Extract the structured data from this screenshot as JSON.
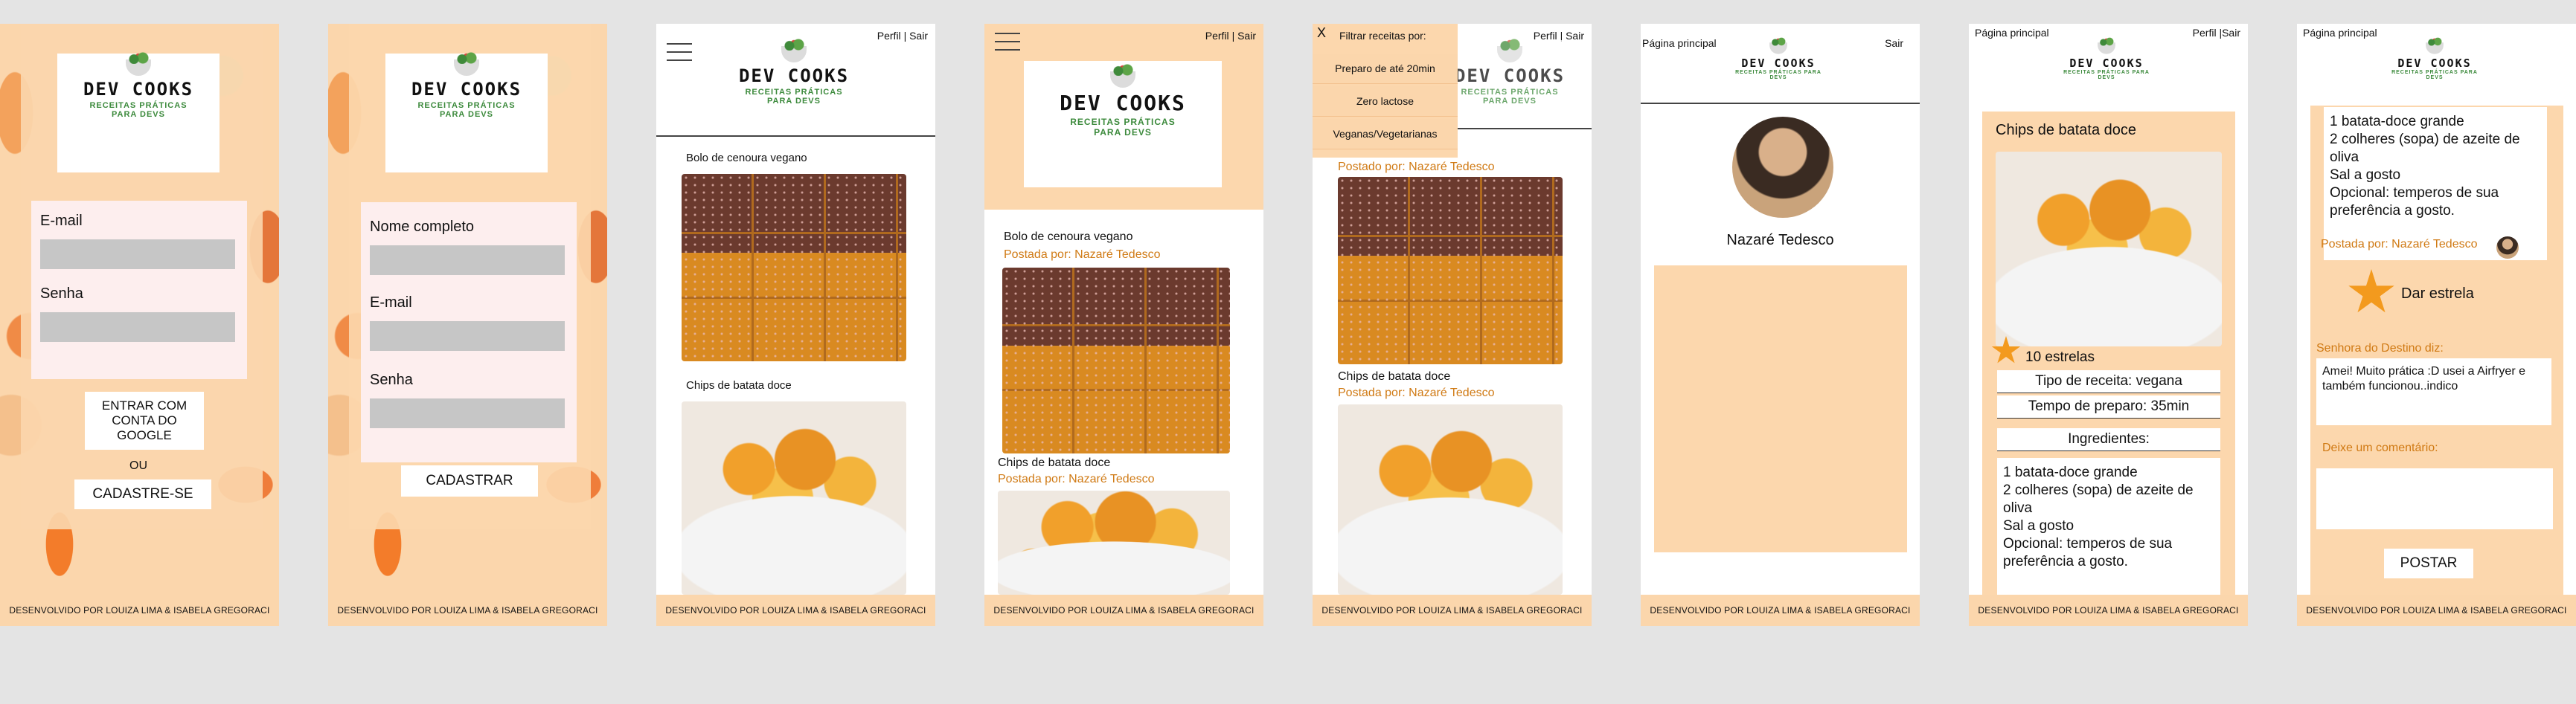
{
  "brand": {
    "name": "DEV COOKS",
    "tagline": "RECEITAS PRÁTICAS PARA DEVS"
  },
  "footer": "DESENVOLVIDO POR LOUIZA LIMA & ISABELA GREGORACI",
  "login": {
    "email_label": "E-mail",
    "password_label": "Senha",
    "google_button": "ENTRAR COM CONTA DO GOOGLE",
    "or": "OU",
    "signup_button": "CADASTRE-SE"
  },
  "signup": {
    "name_label": "Nome completo",
    "email_label": "E-mail",
    "password_label": "Senha",
    "submit_button": "CADASTRAR"
  },
  "nav": {
    "profile": "Perfil",
    "separator": "|",
    "logout": "Sair",
    "home": "Página principal",
    "profile_logout_compact": "Perfil |Sair"
  },
  "recipes": {
    "carrot_cake": "Bolo de cenoura vegano",
    "sweet_potato_chips": "Chips de batata doce",
    "posted_by": "Postada por: Nazaré Tedesco",
    "posted_by_alt": "Postado por: Nazaré Tedesco"
  },
  "filter_menu": {
    "close": "X",
    "title": "Filtrar receitas por:",
    "options": [
      "Preparo de até 20min",
      "Zero lactose",
      "Veganas/Vegetarianas"
    ]
  },
  "profile": {
    "name": "Nazaré Tedesco"
  },
  "recipe_detail": {
    "title": "Chips de batata doce",
    "stars": "10 estrelas",
    "type": "Tipo de receita: vegana",
    "prep_time": "Tempo de preparo: 35min",
    "ingredients_heading": "Ingredientes:",
    "ingredients": [
      "1 batata-doce grande",
      "2 colheres (sopa) de azeite de oliva",
      "Sal a gosto",
      "Opcional: temperos de sua preferência a gosto."
    ]
  },
  "comments": {
    "posted_by": "Postada por: Nazaré Tedesco",
    "give_star": "Dar estrela",
    "commenter": "Senhora do Destino diz:",
    "comment_text": "Amei! Muito prática :D  usei a Airfryer e também funcionou..indico",
    "leave_comment": "Deixe um comentário:",
    "post_button": "POSTAR"
  },
  "colors": {
    "peach": "#fbd6ac",
    "accent_orange": "#d07a14",
    "brand_green": "#3c8a3c",
    "input_gray": "#c6c6c6"
  }
}
